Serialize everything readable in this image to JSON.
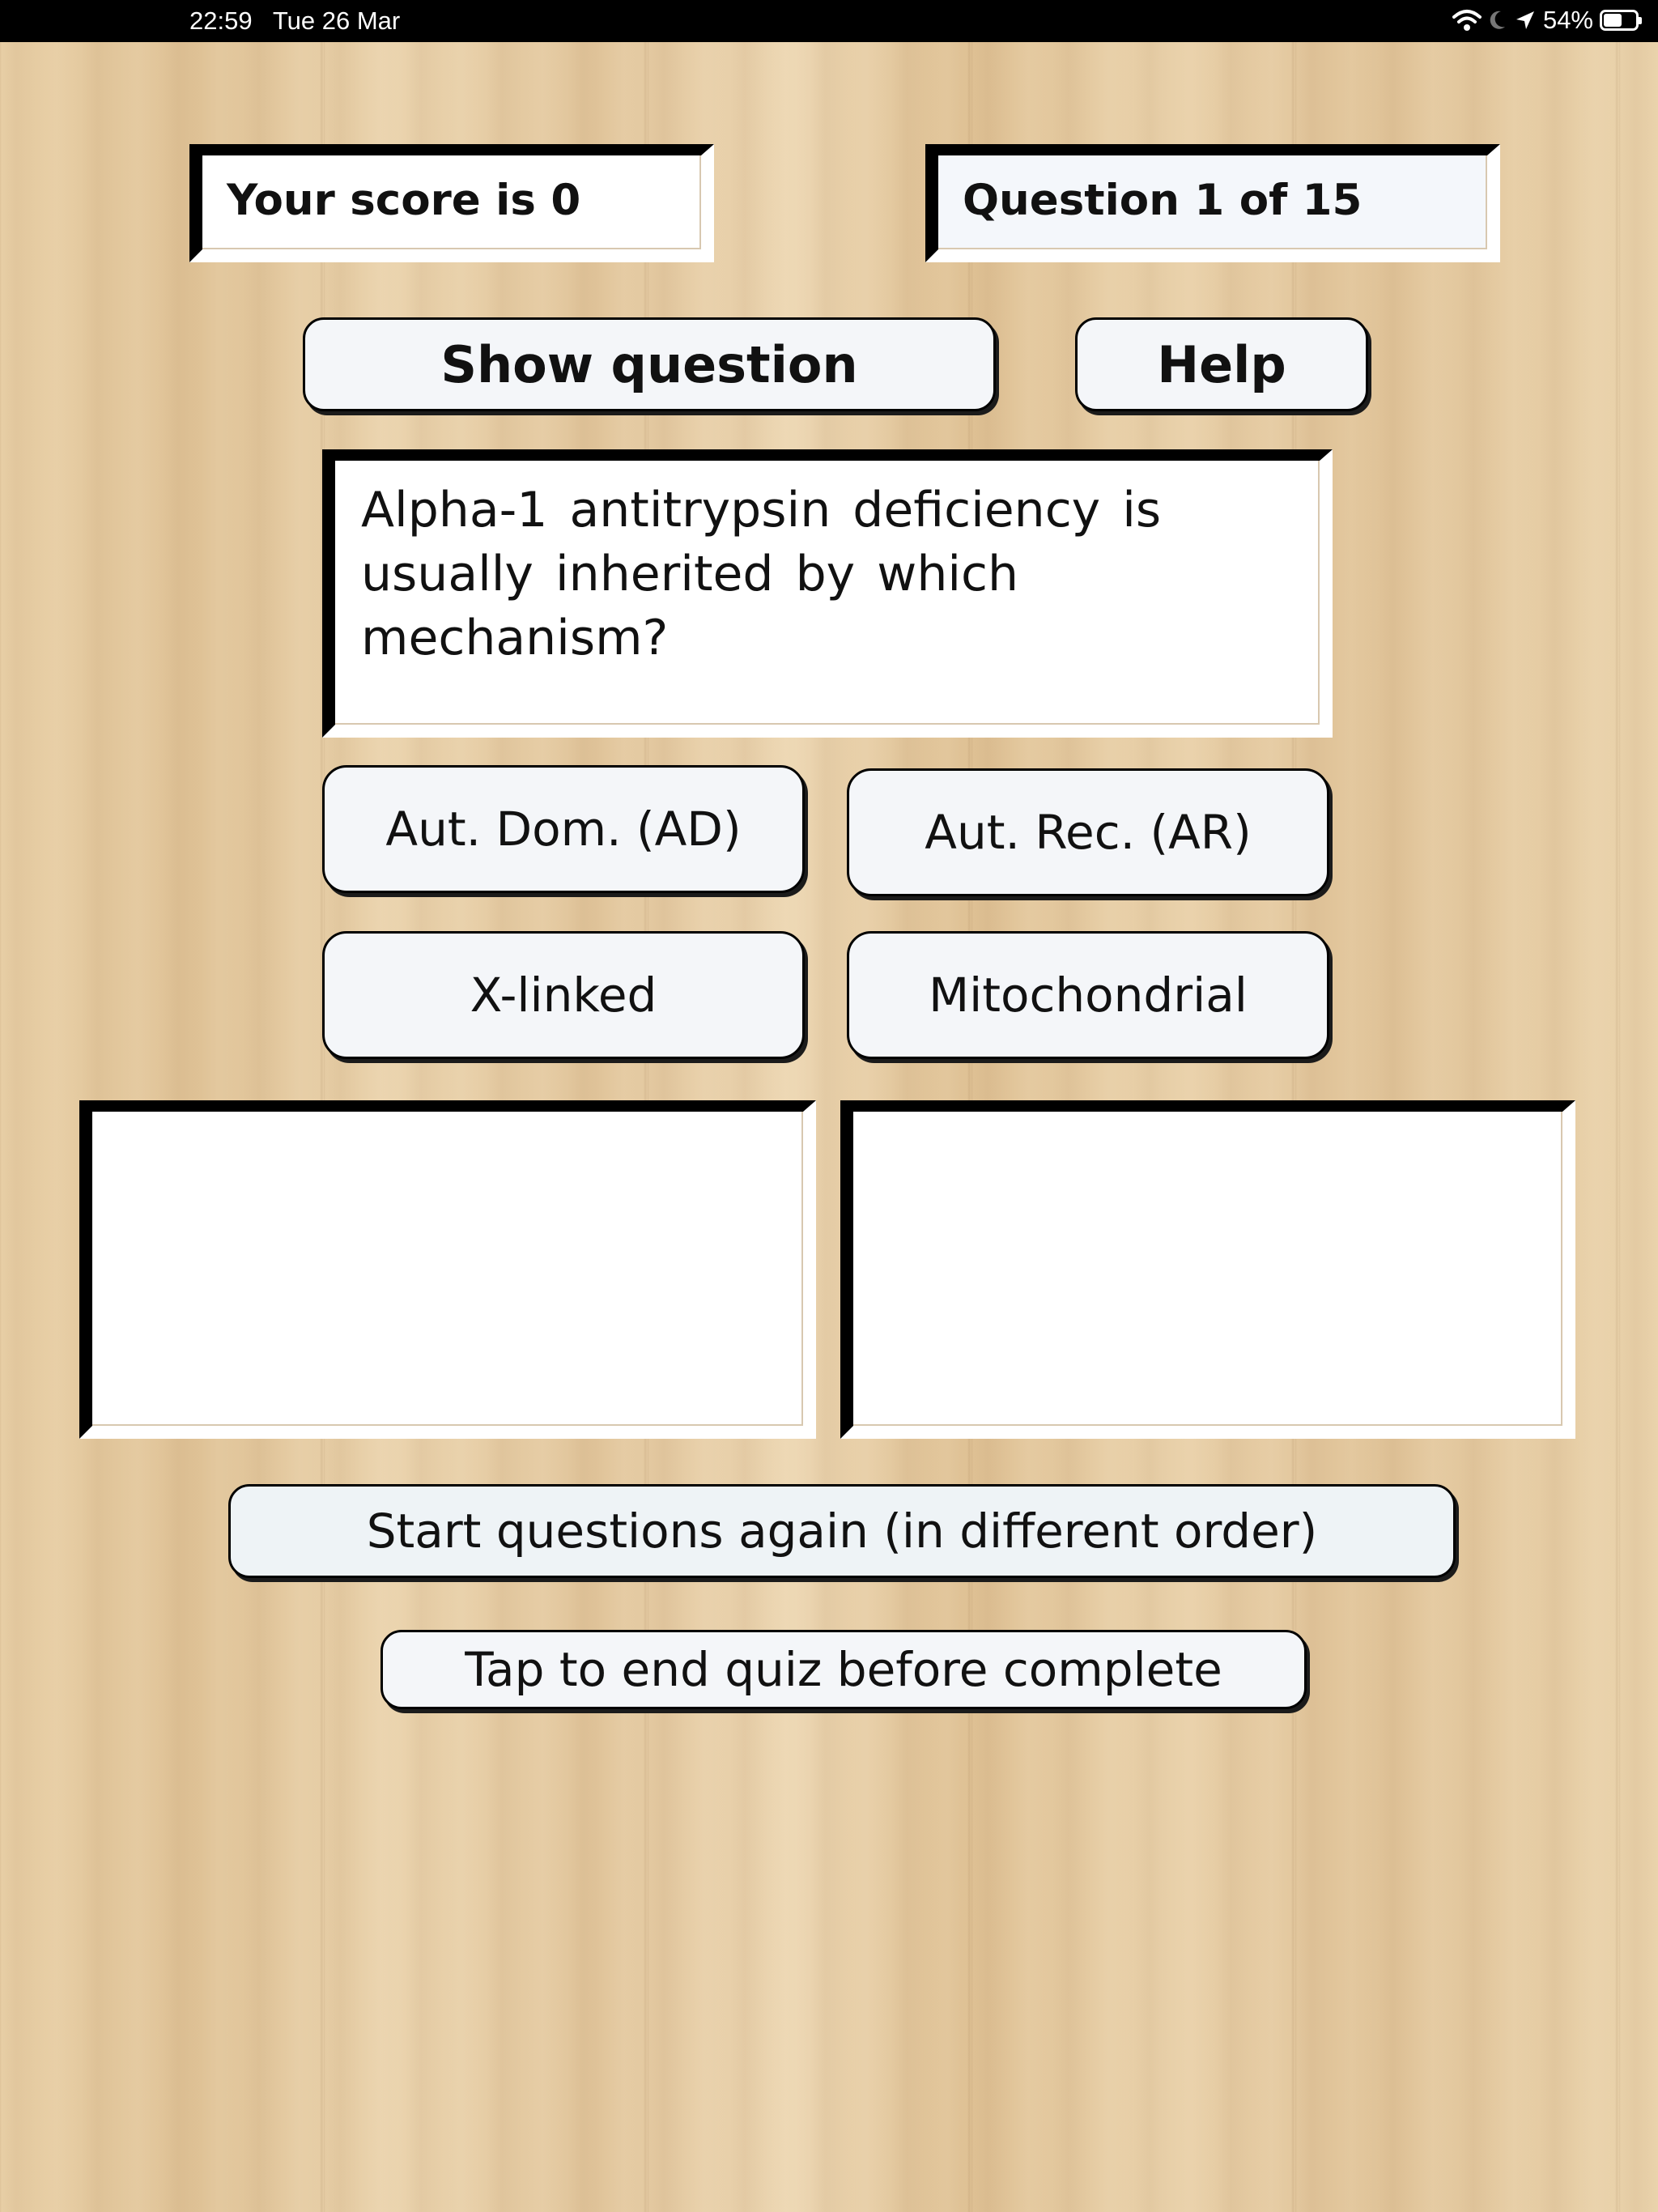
{
  "status_bar": {
    "time": "22:59",
    "date": "Tue 26 Mar",
    "battery": "54%",
    "icons": [
      "wifi-icon",
      "moon-icon",
      "location-arrow-icon",
      "battery-icon"
    ]
  },
  "quiz": {
    "score_text": "Your score is 0",
    "question_counter": "Question 1 of 15",
    "show_question_label": "Show question",
    "help_label": "Help",
    "question_text": "Alpha-1 antitrypsin deficiency  is usually  inherited  by  which mechanism?",
    "answers": [
      {
        "label": "Aut. Dom. (AD)"
      },
      {
        "label": "Aut. Rec. (AR)"
      },
      {
        "label": "X-linked"
      },
      {
        "label": "Mitochondrial"
      }
    ],
    "feedback_left": "",
    "feedback_right": "",
    "restart_label": "Start questions again (in different order)",
    "end_quiz_label": "Tap to end quiz before complete"
  },
  "colors": {
    "button_face": "#f4f6f9",
    "box_border": "#000000",
    "wood_background": "#e3c9a0"
  }
}
